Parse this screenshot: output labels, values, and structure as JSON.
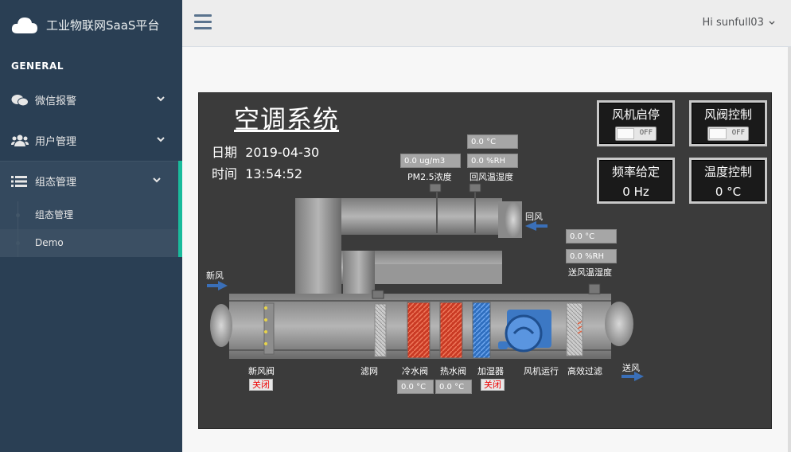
{
  "app": {
    "title": "工业物联网SaaS平台"
  },
  "sidebar": {
    "section": "GENERAL",
    "items": [
      {
        "label": "微信报警",
        "icon": "wechat-icon"
      },
      {
        "label": "用户管理",
        "icon": "users-icon"
      },
      {
        "label": "组态管理",
        "icon": "list-icon"
      }
    ],
    "submenu": [
      {
        "label": "组态管理"
      },
      {
        "label": "Demo"
      }
    ]
  },
  "topbar": {
    "user": "Hi sunfull03"
  },
  "scada": {
    "title": "空调系统",
    "date_label": "日期",
    "date_value": "2019-04-30",
    "time_label": "时间",
    "time_value": "13:54:52",
    "controls": {
      "fan": {
        "label": "风机启停",
        "state": "OFF"
      },
      "damper": {
        "label": "风阀控制",
        "state": "OFF"
      },
      "freq": {
        "label": "频率给定",
        "value": "0 Hz"
      },
      "temp": {
        "label": "温度控制",
        "value": "0 °C"
      }
    },
    "pm25": {
      "value": "0.0 ug/m3",
      "label": "PM2.5浓度"
    },
    "return_air": {
      "temp": "0.0 °C",
      "rh": "0.0 %RH",
      "label": "回风温湿度"
    },
    "supply_air": {
      "temp": "0.0 °C",
      "rh": "0.0 %RH",
      "label": "送风温湿度"
    },
    "labels": {
      "return": "回风",
      "fresh": "新风",
      "supply": "送风",
      "fresh_damper": "新风阀",
      "filter": "滤网",
      "cold_valve": "冷水阀",
      "hot_valve": "热水阀",
      "humidifier": "加湿器",
      "fan_run": "风机运行",
      "hepa": "高效过滤"
    },
    "status": {
      "fresh_damper": "关闭",
      "humidifier": "关闭"
    },
    "valves": {
      "cold": "0.0 °C",
      "hot": "0.0 °C"
    }
  }
}
